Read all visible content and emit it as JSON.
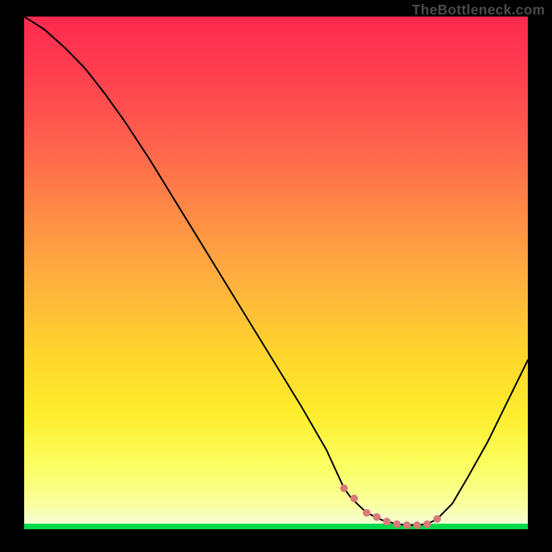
{
  "watermark": "TheBottleneck.com",
  "chart_data": {
    "type": "line",
    "title": "",
    "xlabel": "",
    "ylabel": "",
    "xlim": [
      0,
      100
    ],
    "ylim": [
      0,
      100
    ],
    "series": [
      {
        "name": "bottleneck-curve",
        "x": [
          0,
          4,
          8,
          12,
          16,
          20,
          25,
          30,
          35,
          40,
          45,
          50,
          55,
          60,
          63.5,
          65,
          68,
          71,
          74,
          77,
          80,
          82,
          85,
          88,
          92,
          96,
          100
        ],
        "y": [
          100,
          97.5,
          94,
          90,
          85,
          79.5,
          72,
          64,
          56,
          48,
          40,
          32,
          24,
          15.5,
          8,
          6,
          3.2,
          1.8,
          1.0,
          0.8,
          1.0,
          2.0,
          5,
          10,
          17,
          25,
          33
        ]
      }
    ],
    "highlight_points": {
      "name": "optimum-band-dots",
      "x": [
        63.5,
        65.5,
        68,
        70,
        72,
        74,
        76,
        78,
        80,
        82
      ],
      "y": [
        8,
        6,
        3.2,
        2.4,
        1.5,
        1.0,
        0.8,
        0.8,
        1.0,
        2.0
      ]
    },
    "gradient_stops": [
      {
        "pos": 0,
        "color": "#ff2a4d"
      },
      {
        "pos": 38,
        "color": "#ff8a46"
      },
      {
        "pos": 66,
        "color": "#ffd52c"
      },
      {
        "pos": 95,
        "color": "#f9ff9e"
      },
      {
        "pos": 99,
        "color": "#00d94a"
      }
    ]
  }
}
